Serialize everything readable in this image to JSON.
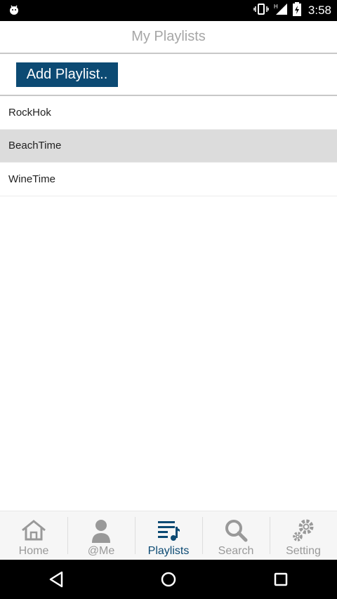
{
  "status_bar": {
    "time": "3:58",
    "icons": [
      "android-icon",
      "vibrate-icon",
      "signal-h-icon",
      "battery-icon"
    ]
  },
  "header": {
    "title": "My Playlists"
  },
  "toolbar": {
    "add_label": "Add Playlist.."
  },
  "playlists": [
    {
      "name": "RockHok",
      "selected": false
    },
    {
      "name": "BeachTime",
      "selected": true
    },
    {
      "name": "WineTime",
      "selected": false
    }
  ],
  "tabs": [
    {
      "label": "Home",
      "icon": "home-icon",
      "active": false
    },
    {
      "label": "@Me",
      "icon": "user-icon",
      "active": false
    },
    {
      "label": "Playlists",
      "icon": "playlist-icon",
      "active": true
    },
    {
      "label": "Search",
      "icon": "search-icon",
      "active": false
    },
    {
      "label": "Setting",
      "icon": "gear-icon",
      "active": false
    }
  ],
  "navbar": {
    "buttons": [
      "back-icon",
      "home-circle-icon",
      "recents-icon"
    ]
  },
  "colors": {
    "accent": "#0c4a73",
    "inactive": "#999999",
    "selected_row": "#dcdcdc"
  }
}
